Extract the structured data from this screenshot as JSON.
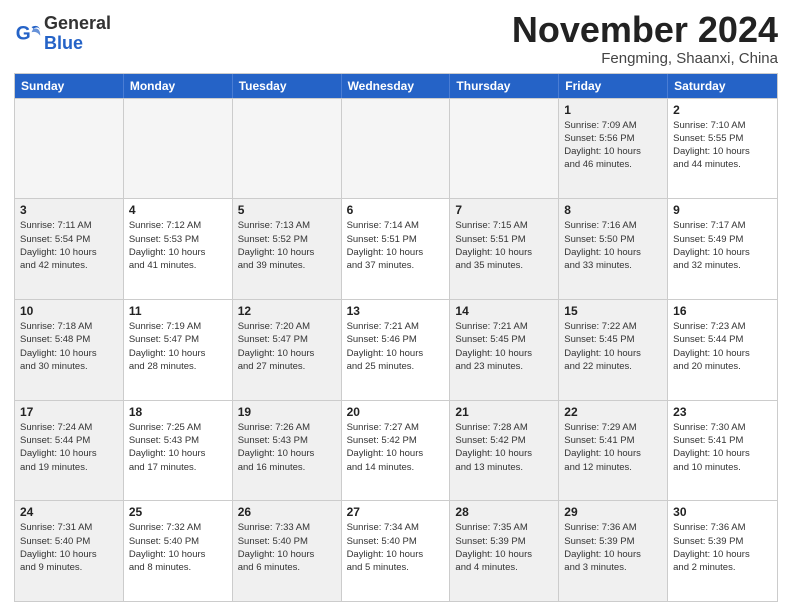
{
  "header": {
    "logo_general": "General",
    "logo_blue": "Blue",
    "month": "November 2024",
    "location": "Fengming, Shaanxi, China"
  },
  "weekdays": [
    "Sunday",
    "Monday",
    "Tuesday",
    "Wednesday",
    "Thursday",
    "Friday",
    "Saturday"
  ],
  "rows": [
    [
      {
        "day": "",
        "empty": true
      },
      {
        "day": "",
        "empty": true
      },
      {
        "day": "",
        "empty": true
      },
      {
        "day": "",
        "empty": true
      },
      {
        "day": "",
        "empty": true
      },
      {
        "day": "1",
        "info": "Sunrise: 7:09 AM\nSunset: 5:56 PM\nDaylight: 10 hours\nand 46 minutes.",
        "shaded": true
      },
      {
        "day": "2",
        "info": "Sunrise: 7:10 AM\nSunset: 5:55 PM\nDaylight: 10 hours\nand 44 minutes.",
        "shaded": false
      }
    ],
    [
      {
        "day": "3",
        "info": "Sunrise: 7:11 AM\nSunset: 5:54 PM\nDaylight: 10 hours\nand 42 minutes.",
        "shaded": true
      },
      {
        "day": "4",
        "info": "Sunrise: 7:12 AM\nSunset: 5:53 PM\nDaylight: 10 hours\nand 41 minutes.",
        "shaded": false
      },
      {
        "day": "5",
        "info": "Sunrise: 7:13 AM\nSunset: 5:52 PM\nDaylight: 10 hours\nand 39 minutes.",
        "shaded": true
      },
      {
        "day": "6",
        "info": "Sunrise: 7:14 AM\nSunset: 5:51 PM\nDaylight: 10 hours\nand 37 minutes.",
        "shaded": false
      },
      {
        "day": "7",
        "info": "Sunrise: 7:15 AM\nSunset: 5:51 PM\nDaylight: 10 hours\nand 35 minutes.",
        "shaded": true
      },
      {
        "day": "8",
        "info": "Sunrise: 7:16 AM\nSunset: 5:50 PM\nDaylight: 10 hours\nand 33 minutes.",
        "shaded": true
      },
      {
        "day": "9",
        "info": "Sunrise: 7:17 AM\nSunset: 5:49 PM\nDaylight: 10 hours\nand 32 minutes.",
        "shaded": false
      }
    ],
    [
      {
        "day": "10",
        "info": "Sunrise: 7:18 AM\nSunset: 5:48 PM\nDaylight: 10 hours\nand 30 minutes.",
        "shaded": true
      },
      {
        "day": "11",
        "info": "Sunrise: 7:19 AM\nSunset: 5:47 PM\nDaylight: 10 hours\nand 28 minutes.",
        "shaded": false
      },
      {
        "day": "12",
        "info": "Sunrise: 7:20 AM\nSunset: 5:47 PM\nDaylight: 10 hours\nand 27 minutes.",
        "shaded": true
      },
      {
        "day": "13",
        "info": "Sunrise: 7:21 AM\nSunset: 5:46 PM\nDaylight: 10 hours\nand 25 minutes.",
        "shaded": false
      },
      {
        "day": "14",
        "info": "Sunrise: 7:21 AM\nSunset: 5:45 PM\nDaylight: 10 hours\nand 23 minutes.",
        "shaded": true
      },
      {
        "day": "15",
        "info": "Sunrise: 7:22 AM\nSunset: 5:45 PM\nDaylight: 10 hours\nand 22 minutes.",
        "shaded": true
      },
      {
        "day": "16",
        "info": "Sunrise: 7:23 AM\nSunset: 5:44 PM\nDaylight: 10 hours\nand 20 minutes.",
        "shaded": false
      }
    ],
    [
      {
        "day": "17",
        "info": "Sunrise: 7:24 AM\nSunset: 5:44 PM\nDaylight: 10 hours\nand 19 minutes.",
        "shaded": true
      },
      {
        "day": "18",
        "info": "Sunrise: 7:25 AM\nSunset: 5:43 PM\nDaylight: 10 hours\nand 17 minutes.",
        "shaded": false
      },
      {
        "day": "19",
        "info": "Sunrise: 7:26 AM\nSunset: 5:43 PM\nDaylight: 10 hours\nand 16 minutes.",
        "shaded": true
      },
      {
        "day": "20",
        "info": "Sunrise: 7:27 AM\nSunset: 5:42 PM\nDaylight: 10 hours\nand 14 minutes.",
        "shaded": false
      },
      {
        "day": "21",
        "info": "Sunrise: 7:28 AM\nSunset: 5:42 PM\nDaylight: 10 hours\nand 13 minutes.",
        "shaded": true
      },
      {
        "day": "22",
        "info": "Sunrise: 7:29 AM\nSunset: 5:41 PM\nDaylight: 10 hours\nand 12 minutes.",
        "shaded": true
      },
      {
        "day": "23",
        "info": "Sunrise: 7:30 AM\nSunset: 5:41 PM\nDaylight: 10 hours\nand 10 minutes.",
        "shaded": false
      }
    ],
    [
      {
        "day": "24",
        "info": "Sunrise: 7:31 AM\nSunset: 5:40 PM\nDaylight: 10 hours\nand 9 minutes.",
        "shaded": true
      },
      {
        "day": "25",
        "info": "Sunrise: 7:32 AM\nSunset: 5:40 PM\nDaylight: 10 hours\nand 8 minutes.",
        "shaded": false
      },
      {
        "day": "26",
        "info": "Sunrise: 7:33 AM\nSunset: 5:40 PM\nDaylight: 10 hours\nand 6 minutes.",
        "shaded": true
      },
      {
        "day": "27",
        "info": "Sunrise: 7:34 AM\nSunset: 5:40 PM\nDaylight: 10 hours\nand 5 minutes.",
        "shaded": false
      },
      {
        "day": "28",
        "info": "Sunrise: 7:35 AM\nSunset: 5:39 PM\nDaylight: 10 hours\nand 4 minutes.",
        "shaded": true
      },
      {
        "day": "29",
        "info": "Sunrise: 7:36 AM\nSunset: 5:39 PM\nDaylight: 10 hours\nand 3 minutes.",
        "shaded": true
      },
      {
        "day": "30",
        "info": "Sunrise: 7:36 AM\nSunset: 5:39 PM\nDaylight: 10 hours\nand 2 minutes.",
        "shaded": false
      }
    ]
  ]
}
